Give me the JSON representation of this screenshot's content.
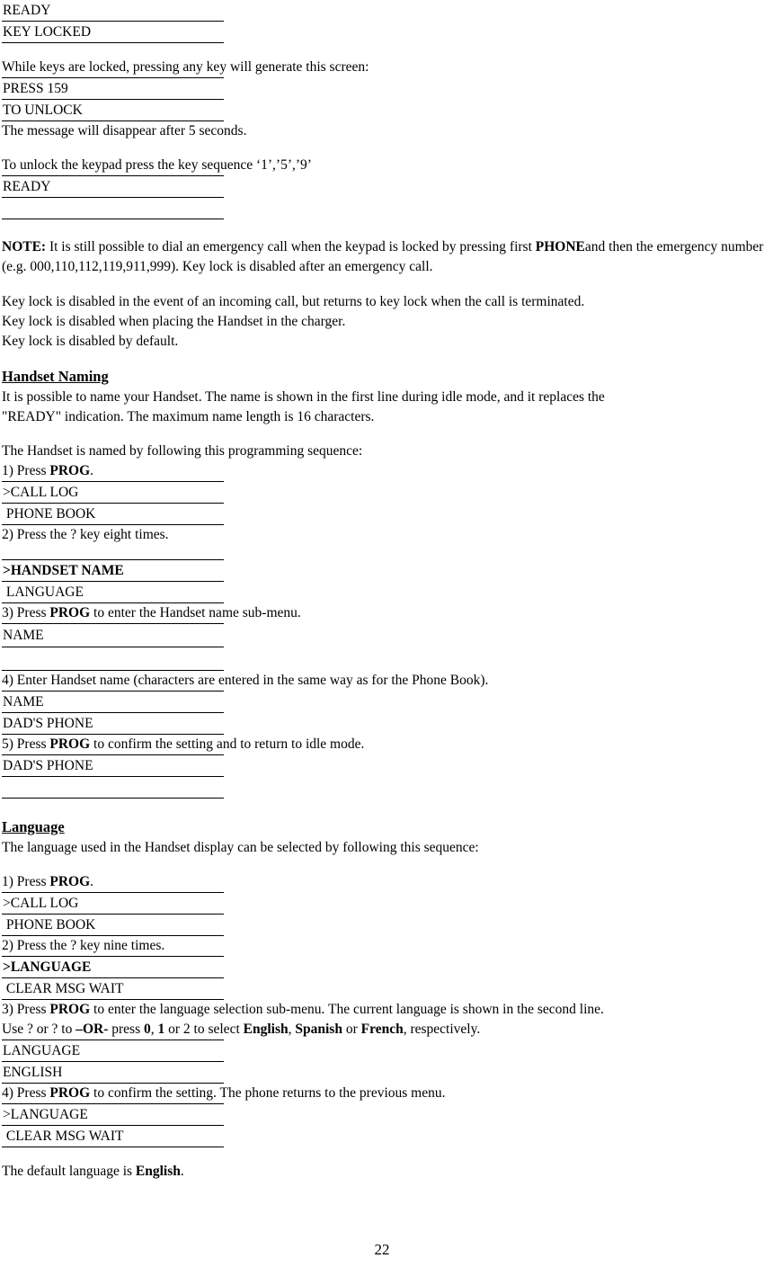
{
  "page": {
    "number": "22"
  },
  "display_top": {
    "line1": "READY",
    "line2": "KEY LOCKED"
  },
  "keylock": {
    "intro": "While keys are locked, pressing any key will generate this screen:",
    "press_display": {
      "line1": "PRESS 159",
      "line2": "TO UNLOCK"
    },
    "disappear": "The message will disappear after 5 seconds.",
    "unlock_instruction": "To unlock the keypad press the key sequence ‘1’,’5’,’9’",
    "ready_display": {
      "line1": "READY",
      "line2": ""
    },
    "note_label": "NOTE:",
    "note_part1": " It is still possible to dial an emergency call when the keypad is locked by pressing first ",
    "note_bold": "PHONE",
    "note_part2": "and then the emergency number (e.g. 000,110,112,119,911,999). Key lock is disabled after an emergency call.",
    "para1": "Key lock is disabled in the event of an incoming call, but returns to key lock when the call is terminated.",
    "para2": "Key lock is disabled when placing the Handset in the charger.",
    "para3": "Key lock is disabled by default."
  },
  "handset_naming": {
    "heading": "Handset Naming",
    "intro1": "It is possible to name your Handset. The name is shown in the first line during idle mode, and it replaces the",
    "intro2": "\"READY\" indication.  The maximum name length is 16 characters.",
    "sequence_intro": "The Handset is named by following this programming sequence:",
    "step1_pre": "1) Press ",
    "step1_bold": "PROG",
    "step1_post": ".",
    "display1": {
      "line1": ">CALL LOG",
      "line2": " PHONE BOOK"
    },
    "step2": "2) Press the ?   key eight times.",
    "display2": {
      "line1": ">HANDSET NAME",
      "line2": " LANGUAGE"
    },
    "step3_pre": "3) Press ",
    "step3_bold": "PROG",
    "step3_post": " to enter the Handset name sub-menu.",
    "display3": {
      "line1": "NAME",
      "line2": ""
    },
    "step4": "4) Enter Handset name (characters are entered in the same way as for the Phone Book).",
    "display4": {
      "line1": "NAME",
      "line2": "DAD'S PHONE"
    },
    "step5_pre": "5) Press ",
    "step5_bold": "PROG",
    "step5_post": " to confirm the setting  and to return to idle mode.",
    "display5": {
      "line1": "DAD'S PHONE",
      "line2": ""
    }
  },
  "language": {
    "heading": "Language",
    "intro": "The language used in the Handset display can be selected by following this sequence:",
    "step1_pre": "1) Press ",
    "step1_bold": "PROG",
    "step1_post": ".",
    "display1": {
      "line1": ">CALL LOG",
      "line2": " PHONE BOOK"
    },
    "step2": "2) Press the ?   key nine times.",
    "display2": {
      "line1": ">LANGUAGE",
      "line2": " CLEAR MSG WAIT"
    },
    "step3_pre": "3) Press ",
    "step3_bold": "PROG",
    "step3_mid": " to enter the language selection sub-menu. The current language is shown in the second line.",
    "step3_line2_pre": "Use ?   or ?   to ",
    "step3_line2_b1": "–OR-",
    "step3_line2_mid1": " press ",
    "step3_line2_b2": "0",
    "step3_line2_mid2": ", ",
    "step3_line2_b3": "1",
    "step3_line2_mid3": " or 2 to select ",
    "step3_line2_b4": "English",
    "step3_line2_mid4": ", ",
    "step3_line2_b5": "Spanish",
    "step3_line2_mid5": " or ",
    "step3_line2_b6": "French",
    "step3_line2_end": ", respectively.",
    "display3": {
      "line1": "LANGUAGE",
      "line2": "ENGLISH"
    },
    "step4_pre": "4) Press ",
    "step4_bold": "PROG",
    "step4_post": " to confirm the setting. The phone returns to the previous menu.",
    "display4": {
      "line1": ">LANGUAGE",
      "line2": " CLEAR MSG WAIT"
    },
    "default_pre": "The default language is ",
    "default_bold": "English",
    "default_post": "."
  }
}
